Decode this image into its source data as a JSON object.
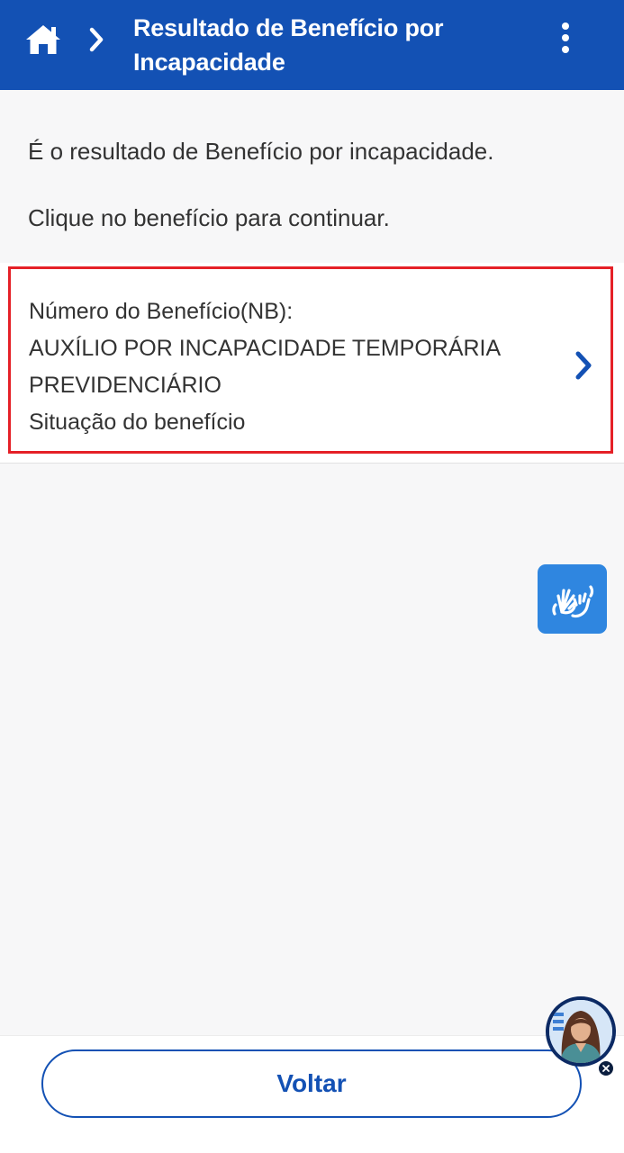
{
  "colors": {
    "primary": "#1351b4",
    "highlight_border": "#e52027",
    "libras": "#2f86e0",
    "text": "#333333",
    "background": "#f7f7f8"
  },
  "header": {
    "home_icon": "home-icon",
    "separator_icon": "chevron-right-icon",
    "title": "Resultado de Benefício por Incapacidade",
    "menu_icon": "more-vertical-icon"
  },
  "intro": {
    "line1": "É o resultado de Benefício por incapacidade.",
    "line2": "Clique no benefício para continuar."
  },
  "benefit": {
    "number_label": "Número do Benefício(NB):",
    "type_line1": "AUXÍLIO POR INCAPACIDADE TEMPORÁRIA",
    "type_line2": "PREVIDENCIÁRIO",
    "status_label": "Situação do benefício",
    "chevron_icon": "chevron-right-icon"
  },
  "accessibility": {
    "libras_icon": "sign-language-hands-icon"
  },
  "assistant": {
    "avatar_icon": "virtual-assistant-avatar",
    "close_icon": "close-icon"
  },
  "footer": {
    "back_label": "Voltar"
  }
}
